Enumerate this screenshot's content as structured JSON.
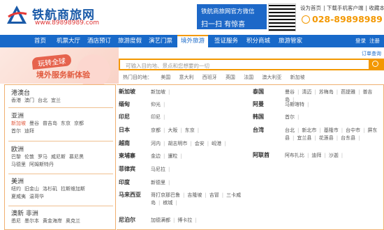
{
  "header": {
    "logo_title": "铁航商旅网",
    "logo_url": "www.89898989.com",
    "wechat_line1": "铁航商旅网官方微信",
    "wechat_line2": "扫一扫  有惊喜",
    "top_links": [
      "设为首页",
      "下载手机客户端",
      "收藏本站"
    ],
    "phone": "028-89898989"
  },
  "nav": {
    "items": [
      "首页",
      "机票大厅",
      "酒店预订",
      "旅游度假",
      "演艺门票",
      "境外旅游",
      "签证服务",
      "积分商城",
      "旅游管家"
    ],
    "active_index": 5,
    "right": [
      "登录",
      "注册"
    ]
  },
  "banner": {
    "tag1": "玩转全球",
    "tag2": "境外服务新体验",
    "search_placeholder": "可输入目的地、景点和您想要的一切",
    "hot_label": "热门目的地：",
    "hot": [
      "美国",
      "意大利",
      "西班牙",
      "英国",
      "法国",
      "澳大利亚",
      "新加坡"
    ],
    "link": "订单查询"
  },
  "regions": [
    {
      "name": "港澳台",
      "cities": [
        "香港",
        "澳门",
        "台北",
        "宜兰"
      ]
    },
    {
      "name": "亚洲",
      "cities": [
        "新加坡",
        "曼谷",
        "普吉岛",
        "东京",
        "京都",
        "首尔",
        "迪拜"
      ]
    },
    {
      "name": "欧洲",
      "cities": [
        "巴黎",
        "伦敦",
        "罗马",
        "威尼斯",
        "慕尼黑",
        "马德里",
        "阿姆斯特丹"
      ]
    },
    {
      "name": "美洲",
      "cities": [
        "纽约",
        "旧金山",
        "洛杉矶",
        "拉斯维加斯",
        "夏威夷",
        "温哥华"
      ]
    },
    {
      "name": "澳新 非洲",
      "cities": [
        "悉尼",
        "墨尔本",
        "黄金海岸",
        "奥克兰"
      ]
    }
  ],
  "countries_left": [
    {
      "name": "新加坡",
      "cities": [
        "新加坡"
      ]
    },
    {
      "name": "缅甸",
      "cities": [
        "仰光"
      ]
    },
    {
      "name": "印尼",
      "cities": [
        "印尼"
      ]
    },
    {
      "name": "日本",
      "cities": [
        "京都",
        "大阪",
        "东京"
      ]
    },
    {
      "name": "越南",
      "cities": [
        "河内",
        "胡志明市",
        "会安",
        "岘港"
      ]
    },
    {
      "name": "柬埔寨",
      "cities": [
        "金边",
        "暹粒"
      ]
    },
    {
      "name": "菲律宾",
      "cities": [
        "马尼拉"
      ]
    },
    {
      "name": "印度",
      "cities": [
        "新德里"
      ]
    },
    {
      "name": "马来西亚",
      "cities": [
        "哥打京那巴鲁",
        "吉隆坡",
        "吉冒",
        "三卡威岛",
        "槟城"
      ]
    },
    {
      "name": "尼泊尔",
      "cities": [
        "加德满都",
        "博卡拉"
      ]
    }
  ],
  "countries_right": [
    {
      "name": "泰国",
      "cities": [
        "曼谷",
        "清迈",
        "苏梅岛",
        "芭提雅",
        "普吉岛"
      ]
    },
    {
      "name": "阿曼",
      "cities": [
        "马斯喀特"
      ]
    },
    {
      "name": "韩国",
      "cities": [
        "首尔"
      ]
    },
    {
      "name": "台湾",
      "cities": [
        "台北",
        "新北市",
        "基隆市",
        "台中市",
        "屏东县",
        "宜兰县",
        "花莲县",
        "台东县"
      ]
    },
    {
      "name": "阿联酋",
      "cities": [
        "阿布扎比",
        "迪拜",
        "沙迦"
      ]
    }
  ]
}
